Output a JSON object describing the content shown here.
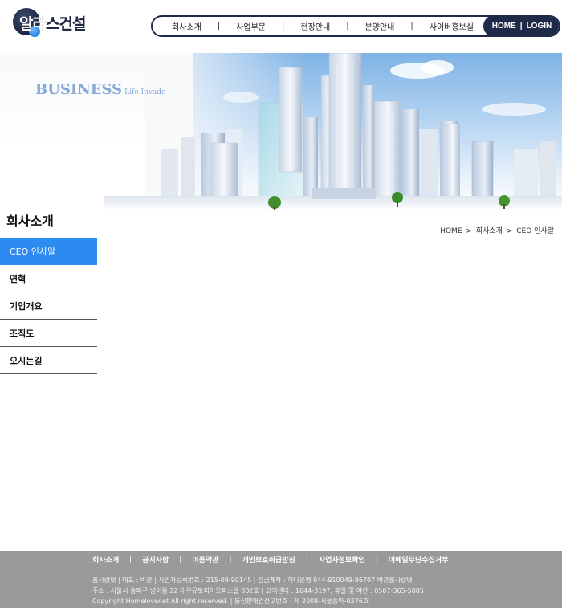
{
  "header": {
    "logo_text_a": "알라",
    "logo_text_b": "스건설",
    "nav": [
      "회사소개",
      "사업부문",
      "현장안내",
      "분양안내",
      "사이버홍보실"
    ],
    "home_label": "HOME",
    "login_label": "LOGIN",
    "divider": "|"
  },
  "banner": {
    "title_big": "BUSINESS",
    "title_small": "Life Invade"
  },
  "section": {
    "title": "회사소개"
  },
  "breadcrumb": {
    "items": [
      "HOME",
      "회사소개",
      "CEO 인사말"
    ],
    "separator": ">"
  },
  "sidebar": {
    "items": [
      {
        "label": "CEO 인사말",
        "active": true
      },
      {
        "label": "연혁",
        "active": false
      },
      {
        "label": "기업개요",
        "active": false
      },
      {
        "label": "조직도",
        "active": false
      },
      {
        "label": "오시는길",
        "active": false
      }
    ]
  },
  "footer": {
    "links": [
      "회사소개",
      "공지사항",
      "이용약관",
      "개인보호취급방침",
      "사업자정보확인",
      "이메일무단수집거부"
    ],
    "info_lines": [
      "홈사랑넷  |  대표 : 박관  |  사업자등록번호 : 215-09-90145  |  입금계좌 : 하나은행 844-910049-86707 박관홈사랑넷",
      "주소 : 서울시 송파구 방이동 22 대우유토피아오피스텔 802호  |  고객센터 : 1644-3197, 휴일 및 야간 : 0507-365-5885",
      "Copyright Homelovenet All right reserved.  |  통신판매업신고번호 : 제 2008-서울송파-0276호"
    ]
  },
  "colors": {
    "navy": "#1f2a48",
    "active_blue": "#2d8af0",
    "footer_gray": "#9a9a9a",
    "banner_text": "#86a8d6"
  }
}
